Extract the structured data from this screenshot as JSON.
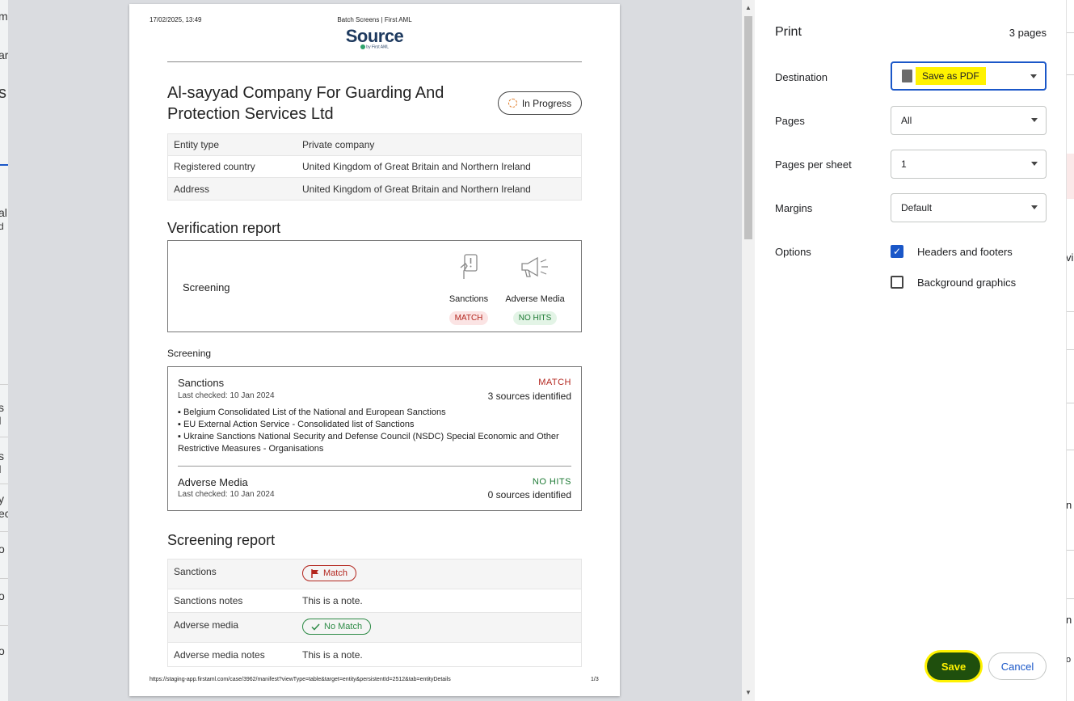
{
  "page_header": {
    "date": "17/02/2025, 13:49",
    "title": "Batch Screens | First AML",
    "logo": "Source",
    "logo_sub": "by First AML"
  },
  "company": {
    "name": "Al-sayyad Company For Guarding And Protection Services Ltd",
    "status": "In Progress",
    "details": [
      {
        "key": "Entity type",
        "value": "Private company"
      },
      {
        "key": "Registered country",
        "value": "United Kingdom of Great Britain and Northern Ireland"
      },
      {
        "key": "Address",
        "value": "United Kingdom of Great Britain and Northern Ireland"
      }
    ]
  },
  "verification": {
    "title": "Verification report",
    "row_label": "Screening",
    "checks": [
      {
        "name": "Sanctions",
        "badge": "MATCH"
      },
      {
        "name": "Adverse Media",
        "badge": "NO HITS"
      }
    ]
  },
  "screening": {
    "label": "Screening",
    "sanctions": {
      "title": "Sanctions",
      "last_checked": "Last checked: 10 Jan 2024",
      "status": "MATCH",
      "sources": "3 sources identified",
      "list": [
        "▪ Belgium Consolidated List of the National and European Sanctions",
        "▪ EU External Action Service - Consolidated list of Sanctions",
        "▪ Ukraine Sanctions National Security and Defense Council (NSDC) Special Economic and Other Restrictive Measures - Organisations"
      ]
    },
    "adverse": {
      "title": "Adverse Media",
      "last_checked": "Last checked: 10 Jan 2024",
      "status": "NO HITS",
      "sources": "0 sources identified"
    }
  },
  "screening_report": {
    "title": "Screening report",
    "rows": [
      {
        "key": "Sanctions",
        "value": "Match"
      },
      {
        "key": "Sanctions notes",
        "value": "This is a note."
      },
      {
        "key": "Adverse media",
        "value": "No Match"
      },
      {
        "key": "Adverse media notes",
        "value": "This is a note."
      }
    ]
  },
  "page_footer": {
    "url": "https://staging-app.firstaml.com/case/3962/manifest?viewType=table&target=entity&persistentId=2512&tab=entityDetails",
    "page": "1/3"
  },
  "print_panel": {
    "title": "Print",
    "page_count": "3 pages",
    "destination_label": "Destination",
    "destination_value": "Save as PDF",
    "pages_label": "Pages",
    "pages_value": "All",
    "pps_label": "Pages per sheet",
    "pps_value": "1",
    "margins_label": "Margins",
    "margins_value": "Default",
    "options_label": "Options",
    "opt_headers": "Headers and footers",
    "opt_headers_checked": true,
    "opt_bg": "Background graphics",
    "opt_bg_checked": false,
    "save": "Save",
    "cancel": "Cancel"
  },
  "background_fragments": {
    "left": [
      "m",
      "ar",
      "s",
      "al",
      "d",
      "s I",
      "s I",
      "y",
      "ec",
      "o",
      "o",
      "o"
    ],
    "right": [
      "vi",
      "n",
      "n",
      "o"
    ]
  },
  "colors": {
    "accent": "#1a57c8",
    "match_red": "#b3261e",
    "nohit_green": "#1e7a35",
    "highlight": "#fff200",
    "save_bg": "#1f4f0d"
  }
}
